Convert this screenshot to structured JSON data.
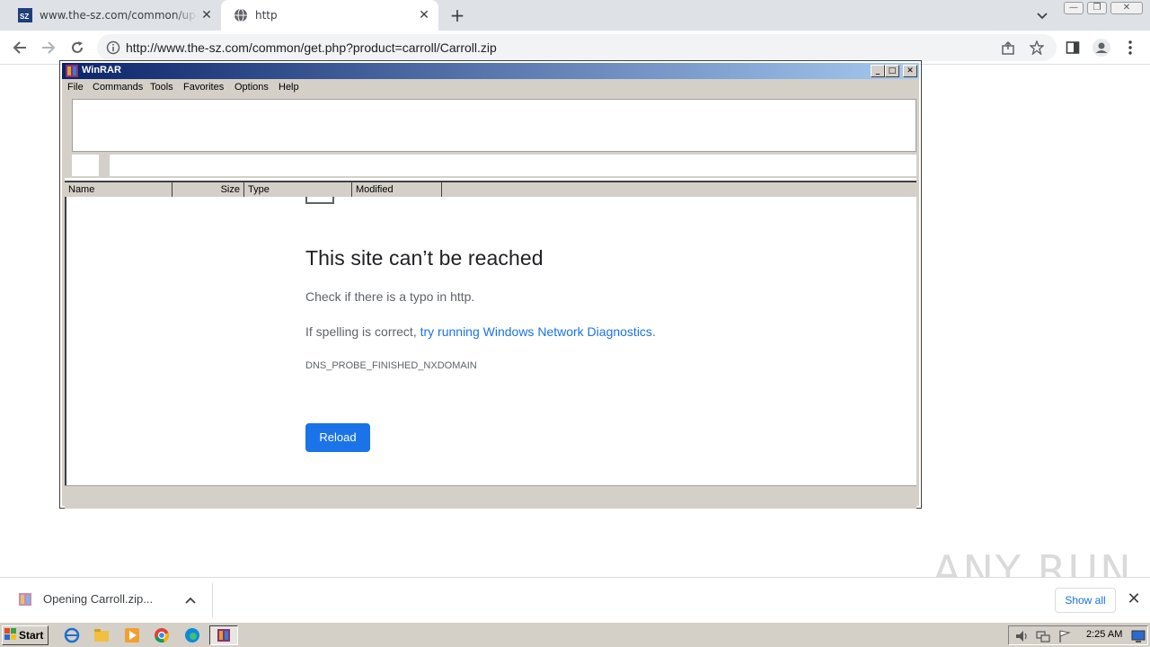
{
  "browser": {
    "tabs": [
      {
        "label": "www.the-sz.com/common/update.php",
        "favicon": "sz-logo-icon"
      },
      {
        "label": "http",
        "favicon": "globe-icon"
      }
    ],
    "address": "http://www.the-sz.com/common/get.php?product=carroll/Carroll.zip"
  },
  "winrar": {
    "title": "WinRAR",
    "menu": [
      "File",
      "Commands",
      "Tools",
      "Favorites",
      "Options",
      "Help"
    ],
    "columns": [
      "Name",
      "Size",
      "Type",
      "Modified"
    ]
  },
  "error_page": {
    "title": "This site can’t be reached",
    "line1": "Check if there is a typo in http.",
    "line2_prefix": "If spelling is correct, ",
    "line2_link": "try running Windows Network Diagnostics",
    "line2_suffix": ".",
    "code": "DNS_PROBE_FINISHED_NXDOMAIN",
    "reload": "Reload"
  },
  "download_shelf": {
    "item": "Opening Carroll.zip...",
    "show_all": "Show all"
  },
  "watermark": "ANY RUN",
  "taskbar": {
    "start": "Start",
    "clock": "2:25 AM"
  },
  "colors": {
    "accent": "#1a73e8",
    "winrar_title_start": "#0a246a",
    "winrar_title_end": "#a6caf0"
  }
}
